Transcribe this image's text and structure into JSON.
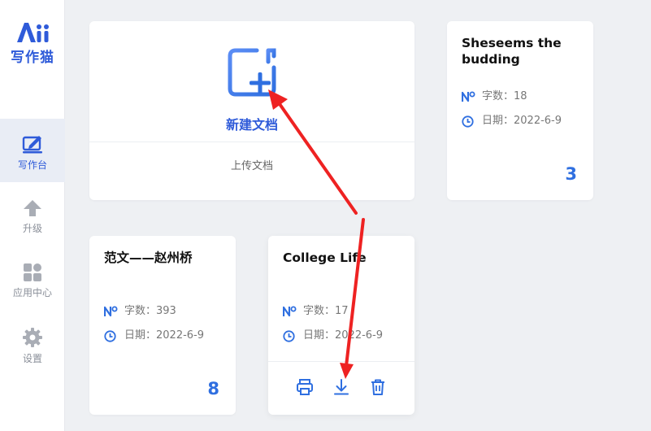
{
  "sidebar": {
    "logo_text": "写作猫",
    "items": [
      {
        "label": "写作台"
      },
      {
        "label": "升级"
      },
      {
        "label": "应用中心"
      },
      {
        "label": "设置"
      }
    ]
  },
  "new_doc": {
    "create_label": "新建文档",
    "upload_label": "上传文档"
  },
  "docs": [
    {
      "title": "Sheseems the budding",
      "word_count": "字数：18",
      "date": "日期：2022-6-9",
      "count": "3"
    },
    {
      "title": "范文——赵州桥",
      "word_count": "字数：393",
      "date": "日期：2022-6-9",
      "count": "8"
    },
    {
      "title": "College Life",
      "word_count": "字数：17",
      "date": "日期：2022-6-9"
    }
  ],
  "colors": {
    "accent": "#2f5bd9",
    "count": "#2f6fe0",
    "annotation_arrow": "#ee2222"
  }
}
